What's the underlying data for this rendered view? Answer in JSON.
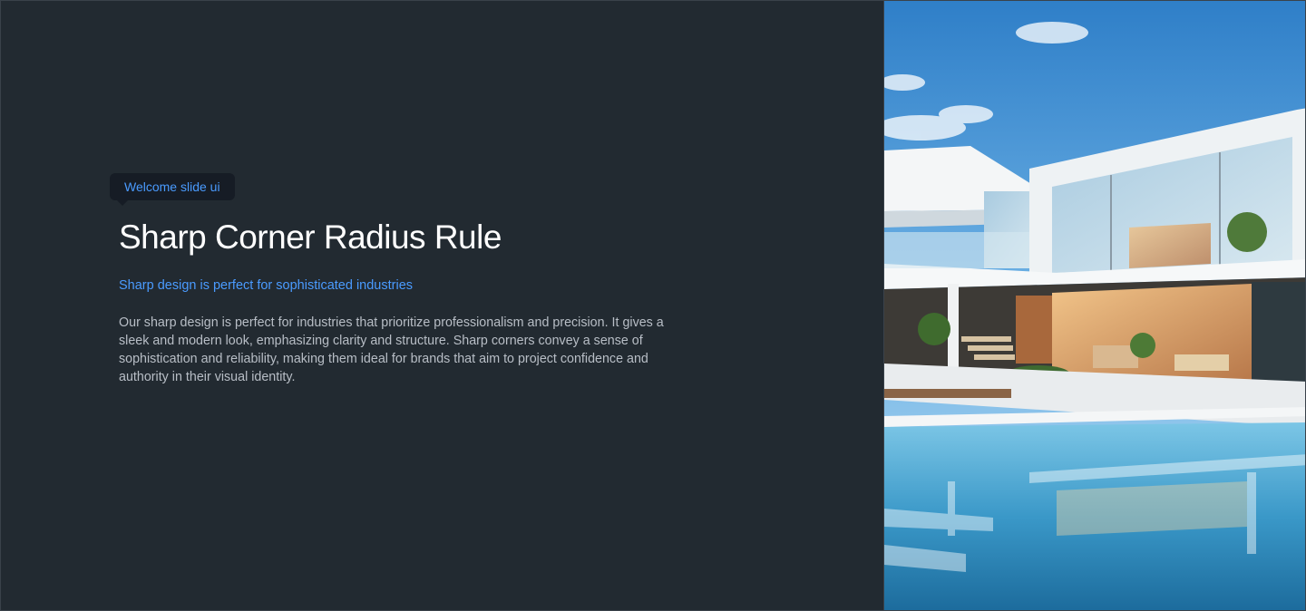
{
  "badge": {
    "label": "Welcome slide ui"
  },
  "hero": {
    "title": "Sharp Corner Radius Rule",
    "subtitle": "Sharp design is perfect for sophisticated industries",
    "body": "Our sharp design is perfect for industries that prioritize professionalism and precision. It gives a sleek and modern look, emphasizing clarity and structure. Sharp corners convey a sense of sophistication and reliability, making them ideal for brands that aim to project confidence and authority in their visual identity."
  },
  "image": {
    "subject": "modern-villa-with-pool-photo"
  },
  "colors": {
    "background": "#222a31",
    "accent": "#4a9bff",
    "title": "#ffffff",
    "body": "#b8bec6",
    "badge_bg": "#161c25"
  }
}
